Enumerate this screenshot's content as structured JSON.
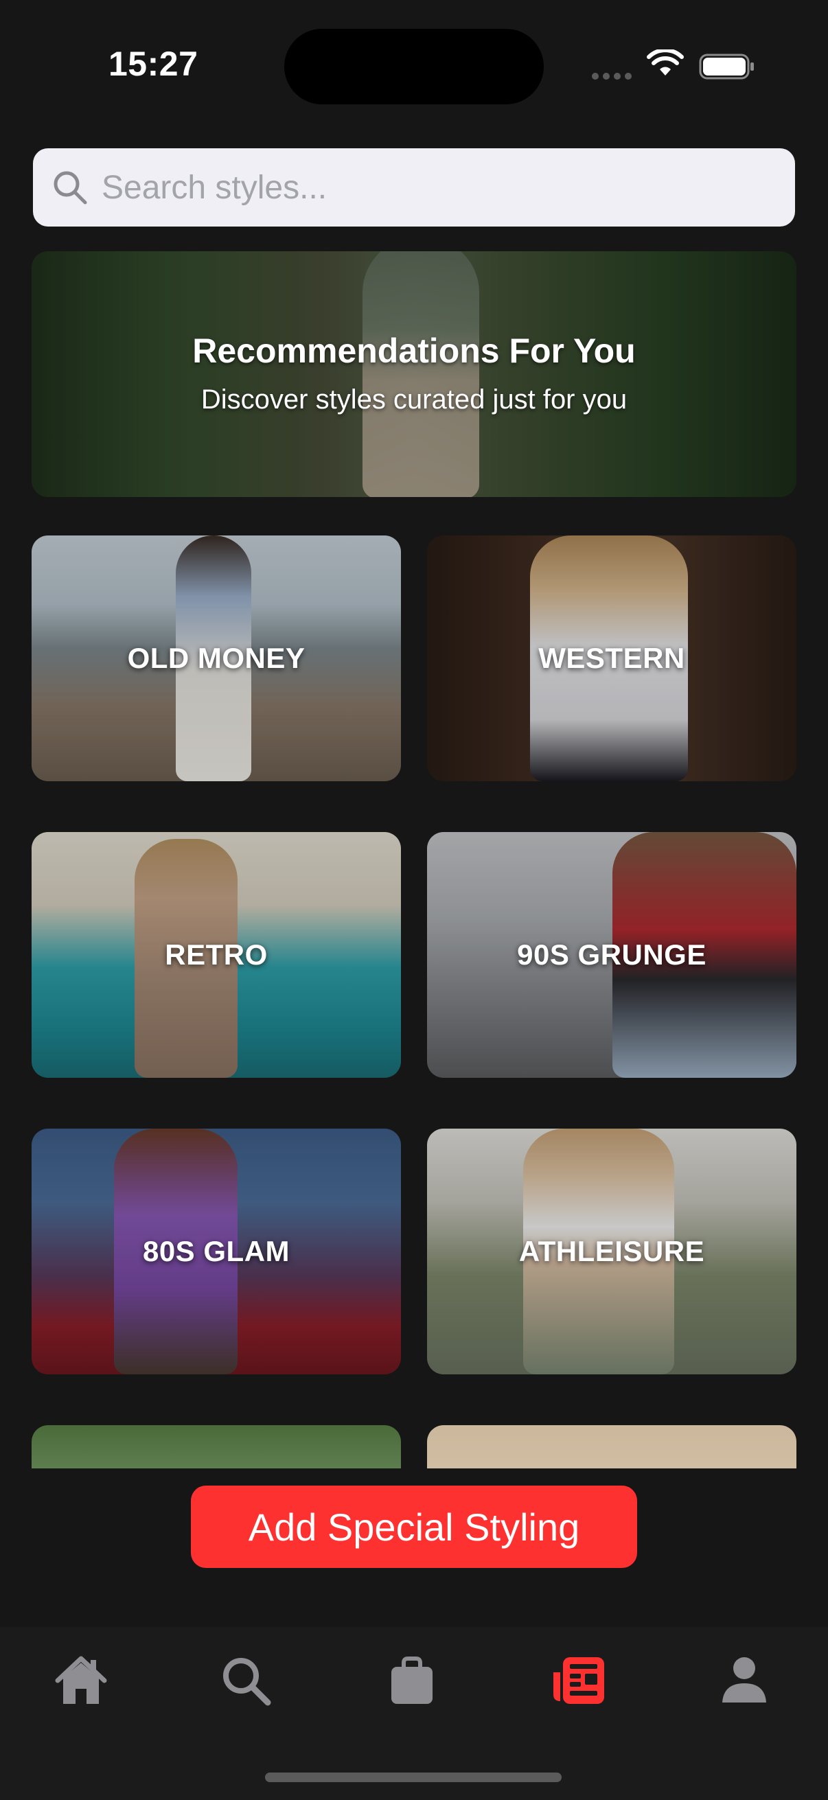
{
  "status_bar": {
    "time": "15:27"
  },
  "search": {
    "placeholder": "Search styles..."
  },
  "hero": {
    "title": "Recommendations For You",
    "subtitle": "Discover styles curated just for you"
  },
  "styles": [
    {
      "label": "OLD MONEY"
    },
    {
      "label": "WESTERN"
    },
    {
      "label": "RETRO"
    },
    {
      "label": "90S GRUNGE"
    },
    {
      "label": "80S GLAM"
    },
    {
      "label": "ATHLEISURE"
    }
  ],
  "action": {
    "label": "Add Special Styling"
  },
  "tab_bar": {
    "items": [
      {
        "icon": "home-icon",
        "active": false
      },
      {
        "icon": "search-icon",
        "active": false
      },
      {
        "icon": "bag-icon",
        "active": false
      },
      {
        "icon": "styles-icon",
        "active": true
      },
      {
        "icon": "profile-icon",
        "active": false
      }
    ]
  },
  "colors": {
    "background": "#161616",
    "accent": "#fe3131",
    "tab_inactive": "#8e8e93",
    "search_bg": "#f0eff5"
  }
}
